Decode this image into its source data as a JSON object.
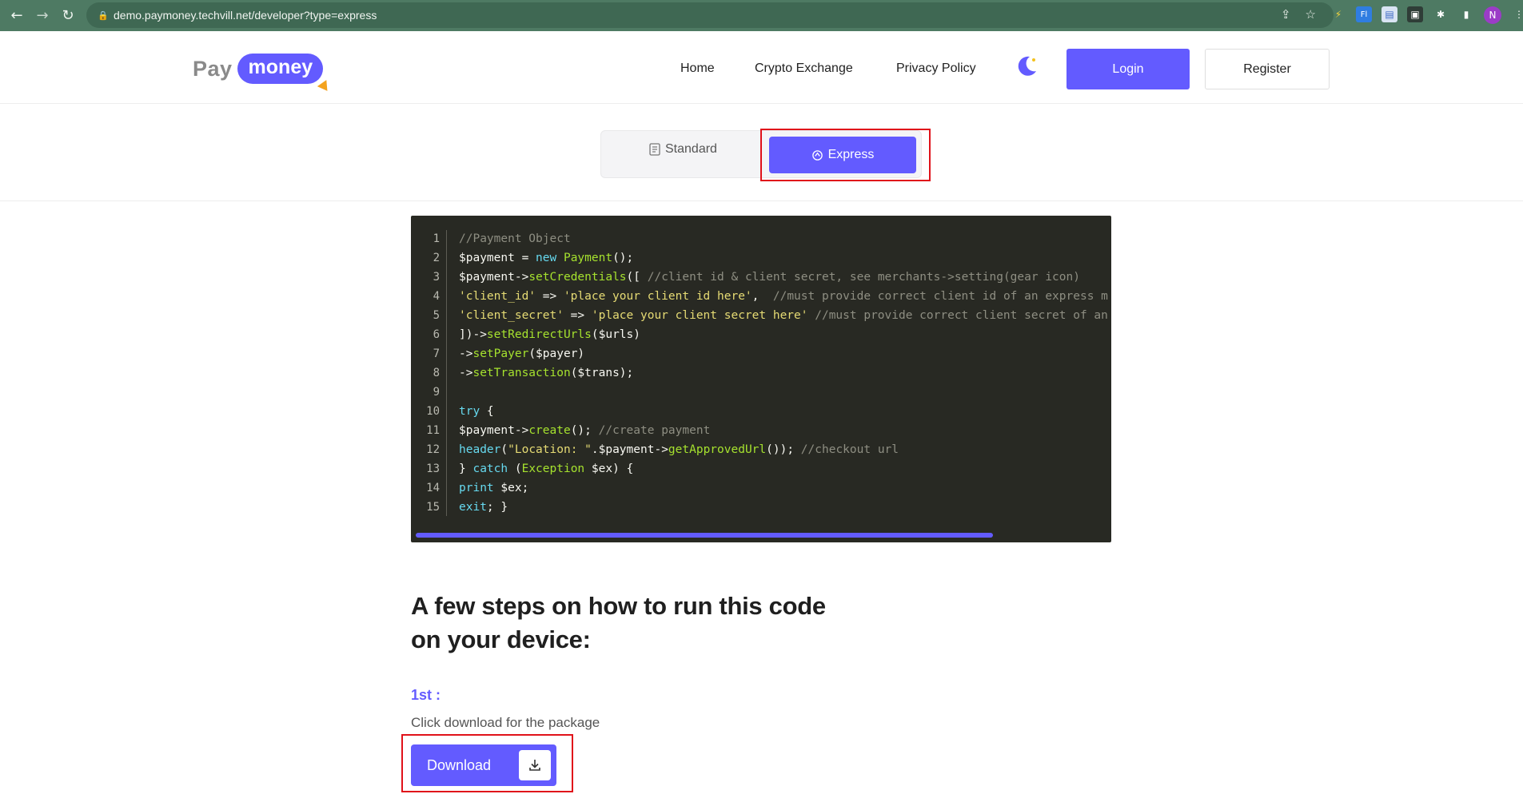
{
  "browser": {
    "url": "demo.paymoney.techvill.net/developer?type=express",
    "avatar_initial": "N"
  },
  "header": {
    "logo_pay": "Pay",
    "logo_money": "money",
    "nav": [
      "Home",
      "Crypto Exchange",
      "Privacy Policy"
    ],
    "login_label": "Login",
    "register_label": "Register"
  },
  "tabs": {
    "standard_label": "Standard",
    "express_label": "Express",
    "active": "Express"
  },
  "code": {
    "line_numbers": [
      "1",
      "2",
      "3",
      "4",
      "5",
      "6",
      "7",
      "8",
      "9",
      "10",
      "11",
      "12",
      "13",
      "14",
      "15"
    ],
    "lines": [
      "//Payment Object",
      "$payment = new Payment();",
      "$payment->setCredentials([ //client id & client secret, see merchants->setting(gear icon)",
      "'client_id' => 'place your client id here',  //must provide correct client id of an express m",
      "'client_secret' => 'place your client secret here' //must provide correct client secret of an",
      "])->setRedirectUrls($urls)",
      "->setPayer($payer)",
      "->setTransaction($trans);",
      "",
      "try {",
      "$payment->create(); //create payment",
      "header(\"Location: \".$payment->getApprovedUrl()); //checkout url",
      "} catch (Exception $ex) {",
      "print $ex;",
      "exit; }"
    ]
  },
  "steps": {
    "title": "A few steps on how to run this code on your device:",
    "step1_num": "1st :",
    "step1_desc": "Click download for the package",
    "download_label": "Download"
  },
  "colors": {
    "brand": "#635bff",
    "highlight": "#e0121a",
    "chrome": "#4e7a63"
  }
}
